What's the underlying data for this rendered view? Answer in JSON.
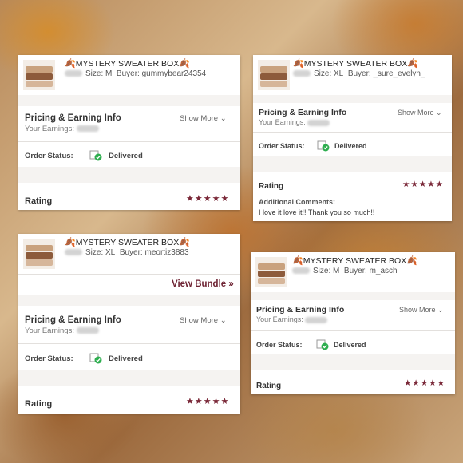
{
  "colors": {
    "accent": "#7a2838",
    "delivered_check": "#2eae4f"
  },
  "cards": [
    {
      "title": "MYSTERY SWEATER BOX",
      "size": "Size: M",
      "buyer": "Buyer: gummybear24354",
      "pricing": "Pricing & Earning Info",
      "earnings": "Your Earnings:",
      "show_more": "Show More",
      "order_status": "Order Status:",
      "delivered": "Delivered",
      "rating": "Rating",
      "stars": "★★★★★"
    },
    {
      "title": "MYSTERY SWEATER BOX",
      "size": "Size: XL",
      "buyer": "Buyer: _sure_evelyn_",
      "pricing": "Pricing & Earning Info",
      "earnings": "Your Earnings:",
      "show_more": "Show More",
      "order_status": "Order Status:",
      "delivered": "Delivered",
      "rating": "Rating",
      "stars": "★★★★★",
      "comments_label": "Additional Comments:",
      "comments_text": "I love it love it!! Thank you so much!!"
    },
    {
      "title": "MYSTERY SWEATER BOX",
      "size": "Size: XL",
      "buyer": "Buyer: meortiz3883",
      "view_bundle": "View Bundle »",
      "pricing": "Pricing & Earning Info",
      "earnings": "Your Earnings:",
      "show_more": "Show More",
      "order_status": "Order Status:",
      "delivered": "Delivered",
      "rating": "Rating",
      "stars": "★★★★★"
    },
    {
      "title": "MYSTERY SWEATER BOX",
      "size": "Size: M",
      "buyer": "Buyer: m_asch",
      "pricing": "Pricing & Earning Info",
      "earnings": "Your Earnings:",
      "show_more": "Show More",
      "order_status": "Order Status:",
      "delivered": "Delivered",
      "rating": "Rating",
      "stars": "★★★★★"
    }
  ]
}
